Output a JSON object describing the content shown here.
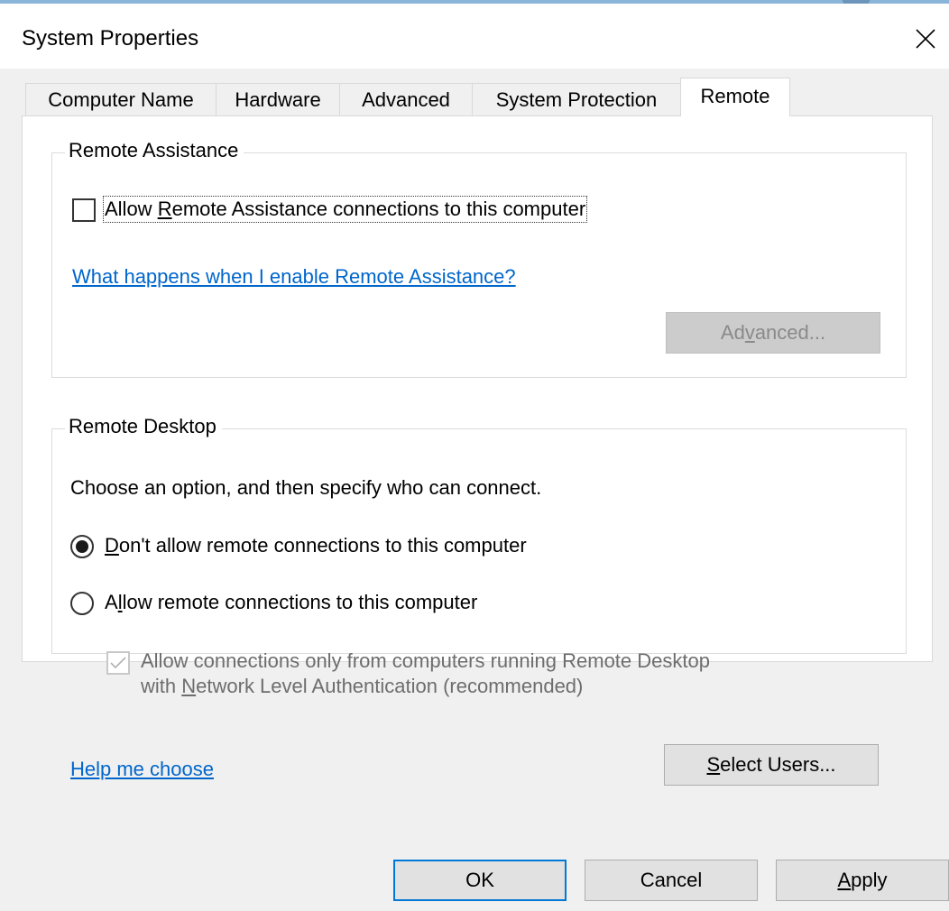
{
  "window": {
    "title": "System Properties"
  },
  "tabs": [
    {
      "label": "Computer Name"
    },
    {
      "label": "Hardware"
    },
    {
      "label": "Advanced"
    },
    {
      "label": "System Protection"
    },
    {
      "label": "Remote"
    }
  ],
  "active_tab": "Remote",
  "remote_assistance": {
    "legend": "Remote Assistance",
    "allow_checkbox": {
      "pre": "Allow ",
      "accel": "R",
      "post": "emote Assistance connections to this computer",
      "checked": false
    },
    "help_link": "What happens when I enable Remote Assistance?",
    "advanced_button": {
      "pre": "Ad",
      "accel": "v",
      "post": "anced...",
      "enabled": false
    }
  },
  "remote_desktop": {
    "legend": "Remote Desktop",
    "instruction": "Choose an option, and then specify who can connect.",
    "option_dont_allow": {
      "pre": "",
      "accel": "D",
      "post": "on't allow remote connections to this computer",
      "selected": true
    },
    "option_allow": {
      "pre": "A",
      "accel": "l",
      "post": "low remote connections to this computer",
      "selected": false
    },
    "nla_checkbox": {
      "line1": "Allow connections only from computers running Remote Desktop",
      "line2_pre": "with ",
      "line2_accel": "N",
      "line2_post": "etwork Level Authentication (recommended)",
      "checked": true,
      "enabled": false
    },
    "help_link": "Help me choose",
    "select_users_button": {
      "pre": "",
      "accel": "S",
      "post": "elect Users..."
    }
  },
  "footer": {
    "ok": "OK",
    "cancel": "Cancel",
    "apply": {
      "pre": "",
      "accel": "A",
      "post": "pply"
    }
  },
  "colors": {
    "link": "#0066cc",
    "default_button_border": "#0078d7",
    "dialog_bg": "#f0f0f0"
  }
}
